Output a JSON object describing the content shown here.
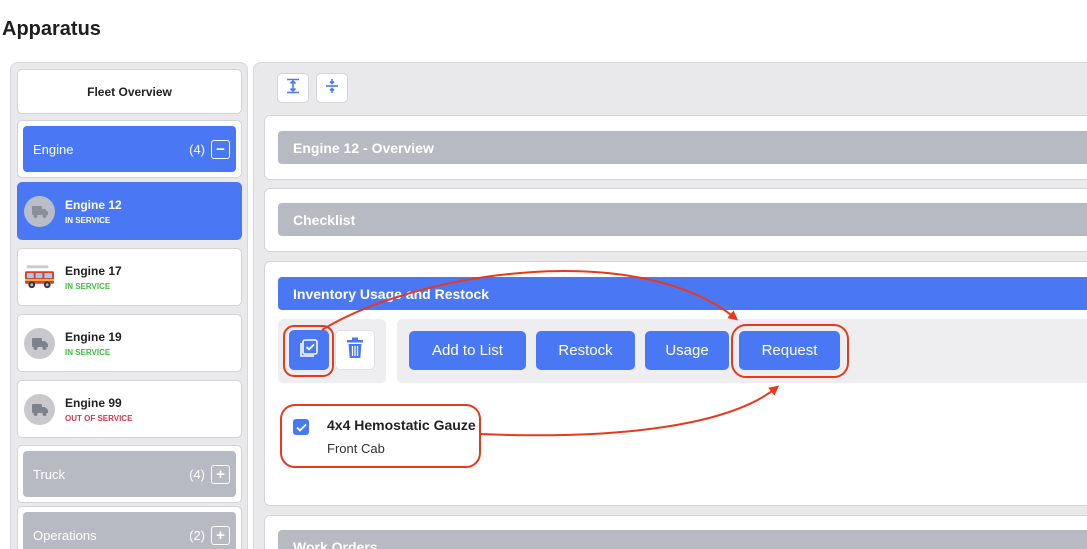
{
  "page": {
    "title": "Apparatus"
  },
  "sidebar": {
    "fleet_overview": "Fleet Overview",
    "groups": [
      {
        "label": "Engine",
        "count": "(4)",
        "toggle": "−",
        "expanded": true
      },
      {
        "label": "Truck",
        "count": "(4)",
        "toggle": "+",
        "expanded": false
      },
      {
        "label": "Operations",
        "count": "(2)",
        "toggle": "+",
        "expanded": false
      }
    ],
    "units": [
      {
        "name": "Engine 12",
        "status": "IN SERVICE",
        "icon": "truck-icon",
        "active": true
      },
      {
        "name": "Engine 17",
        "status": "IN SERVICE",
        "icon": "fire-engine-icon",
        "active": false
      },
      {
        "name": "Engine 19",
        "status": "IN SERVICE",
        "icon": "truck-icon",
        "active": false
      },
      {
        "name": "Engine 99",
        "status": "OUT OF SERVICE",
        "icon": "truck-icon",
        "active": false
      }
    ]
  },
  "main": {
    "toolbar": {
      "expand_icon": "expand-all-icon",
      "collapse_icon": "collapse-all-icon"
    },
    "sections": {
      "overview": "Engine 12 - Overview",
      "checklist": "Checklist",
      "inventory": "Inventory Usage and Restock",
      "work_orders": "Work Orders"
    },
    "inventory": {
      "buttons": {
        "add": "Add to List",
        "restock": "Restock",
        "usage": "Usage",
        "request": "Request"
      },
      "items": [
        {
          "name": "4x4 Hemostatic Gauze",
          "location": "Front Cab",
          "checked": true
        }
      ]
    }
  },
  "colors": {
    "accent": "#4a78f5",
    "header_gray": "#b7bac3",
    "in_service": "#3cc23c",
    "out_of_service": "#d03a4e",
    "annotation": "#e8391d"
  }
}
